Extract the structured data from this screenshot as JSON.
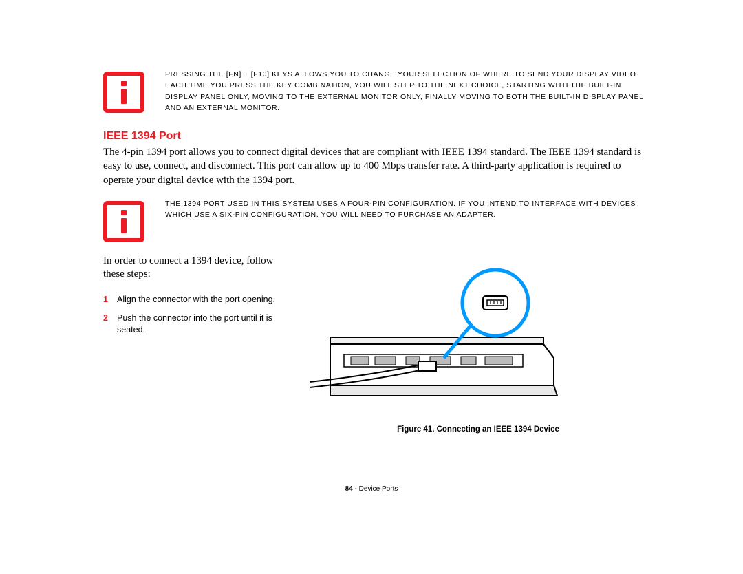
{
  "note1": {
    "text": "Pressing the [Fn] + [F10] keys allows you to change your selection of where to send your display video. Each time you press the key combination, you will step to the next choice, starting with the built-in display panel only, moving to the external monitor only, finally moving to both the built-in display panel and an external monitor."
  },
  "heading": "IEEE 1394 Port",
  "para1": "The 4-pin 1394 port allows you to connect digital devices that are compliant with IEEE 1394 standard. The IEEE 1394 standard is easy to use, connect, and disconnect. This port can allow up to 400 Mbps transfer rate. A third-party application is required to operate your digital device with the 1394 port.",
  "note2": {
    "text": "The 1394 port used in this system uses a four-pin configuration. If you intend to interface with devices which use a six-pin configuration, you will need to purchase an adapter."
  },
  "lead_in": "In order to connect a 1394 device, follow these steps:",
  "steps": [
    {
      "num": "1",
      "text": "Align the connector with the port opening."
    },
    {
      "num": "2",
      "text": "Push the connector into the port until it is seated."
    }
  ],
  "figure_caption": "Figure 41.  Connecting an IEEE 1394 Device",
  "footer": {
    "page": "84",
    "section": "Device Ports"
  }
}
